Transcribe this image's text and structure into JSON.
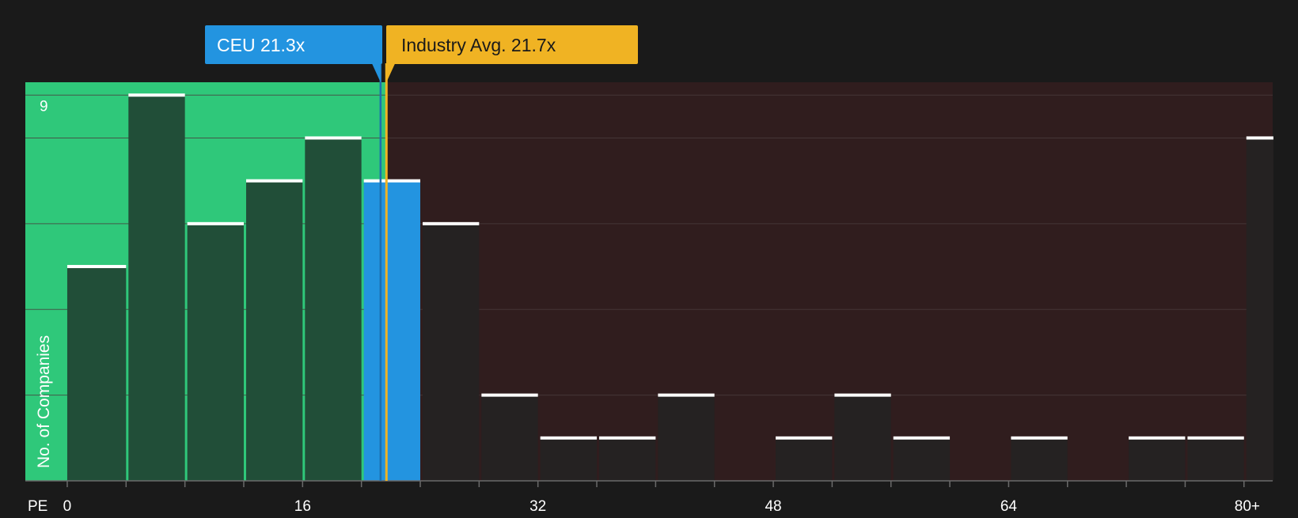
{
  "chart_data": {
    "type": "bar",
    "x_axis_label": "PE",
    "y_axis_label": "No. of Companies",
    "x_ticks": [
      {
        "value": 0,
        "label": "0"
      },
      {
        "value": 16,
        "label": "16"
      },
      {
        "value": 32,
        "label": "32"
      },
      {
        "value": 48,
        "label": "48"
      },
      {
        "value": 64,
        "label": "64"
      },
      {
        "value": 80,
        "label": "80+"
      }
    ],
    "y_ticks": [
      {
        "value": 9,
        "label": "9"
      }
    ],
    "xlim": [
      -2.85,
      81.95
    ],
    "ylim": [
      0,
      9.3
    ],
    "bins": [
      {
        "x0": 0,
        "x1": 4,
        "count": 5
      },
      {
        "x0": 4,
        "x1": 8,
        "count": 9
      },
      {
        "x0": 8,
        "x1": 12,
        "count": 6
      },
      {
        "x0": 12,
        "x1": 16,
        "count": 7
      },
      {
        "x0": 16,
        "x1": 20,
        "count": 8
      },
      {
        "x0": 20,
        "x1": 24,
        "count": 7,
        "highlight": true
      },
      {
        "x0": 24,
        "x1": 28,
        "count": 6
      },
      {
        "x0": 28,
        "x1": 32,
        "count": 2
      },
      {
        "x0": 32,
        "x1": 36,
        "count": 1
      },
      {
        "x0": 36,
        "x1": 40,
        "count": 1
      },
      {
        "x0": 40,
        "x1": 44,
        "count": 2
      },
      {
        "x0": 44,
        "x1": 48,
        "count": 0
      },
      {
        "x0": 48,
        "x1": 52,
        "count": 1
      },
      {
        "x0": 52,
        "x1": 56,
        "count": 2
      },
      {
        "x0": 56,
        "x1": 60,
        "count": 1
      },
      {
        "x0": 60,
        "x1": 64,
        "count": 0
      },
      {
        "x0": 64,
        "x1": 68,
        "count": 1
      },
      {
        "x0": 68,
        "x1": 72,
        "count": 0
      },
      {
        "x0": 72,
        "x1": 76,
        "count": 1
      },
      {
        "x0": 76,
        "x1": 80,
        "count": 1
      },
      {
        "x0": 80,
        "x1": 82,
        "count": 8
      }
    ],
    "markers": [
      {
        "name": "company",
        "label": "CEU 21.3x",
        "value": 21.3,
        "color": "#2394e0"
      },
      {
        "name": "industry",
        "label": "Industry Avg. 21.7x",
        "value": 21.7,
        "color": "#f0b323"
      }
    ],
    "fair_region_max": 21.7,
    "colors": {
      "background": "#1a1a1a",
      "fair_region": "#2fc87a",
      "expensive_region": "#301d1e",
      "bar_fair": "#214e38",
      "bar_expensive": "#252222",
      "bar_highlight": "#2394e0",
      "cap_line": "#ffffff",
      "grid": "#4a3c3c",
      "tick_text": "#ffffff"
    }
  }
}
